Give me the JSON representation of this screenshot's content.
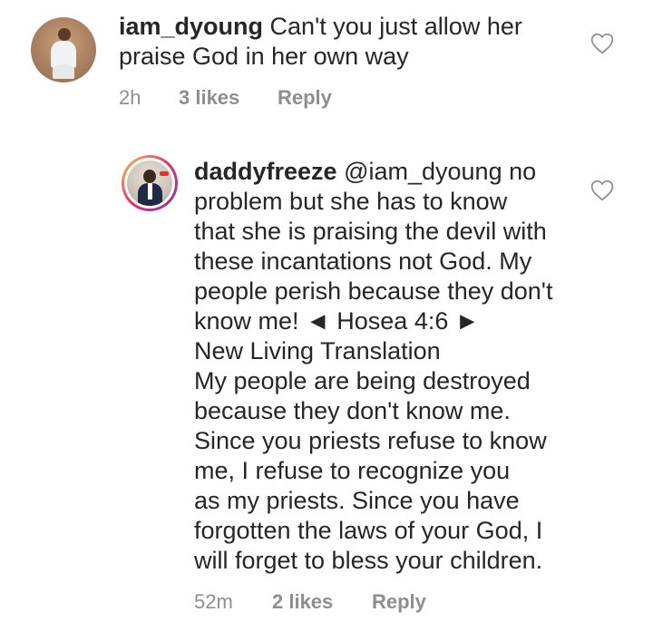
{
  "comments": [
    {
      "username": "iam_dyoung",
      "lines": [
        "Can't you just allow her",
        "praise God in her own way"
      ],
      "time": "2h",
      "likes": "3 likes",
      "reply": "Reply",
      "avatar": "avatar",
      "like_icon": "heart-outline-icon"
    },
    {
      "username": "daddyfreeze",
      "mention": "@iam_dyoung",
      "lines": [
        "no",
        "problem but she has to know",
        "that she is praising the devil with",
        "these incantations not God. My",
        "people perish because they don't",
        "know me! ◄ Hosea 4:6 ►",
        "New Living Translation",
        "My people are being destroyed",
        "because they don't know me.",
        "Since you priests refuse to know",
        "me, I refuse to recognize you",
        "as my priests. Since you have",
        "forgotten the laws of your God, I",
        "will forget to bless your children."
      ],
      "time": "52m",
      "likes": "2 likes",
      "reply": "Reply",
      "avatar": "avatar",
      "like_icon": "heart-outline-icon"
    }
  ],
  "colors": {
    "text": "#262626",
    "meta": "#8e8e8e",
    "story_ring": "#e1306c"
  }
}
